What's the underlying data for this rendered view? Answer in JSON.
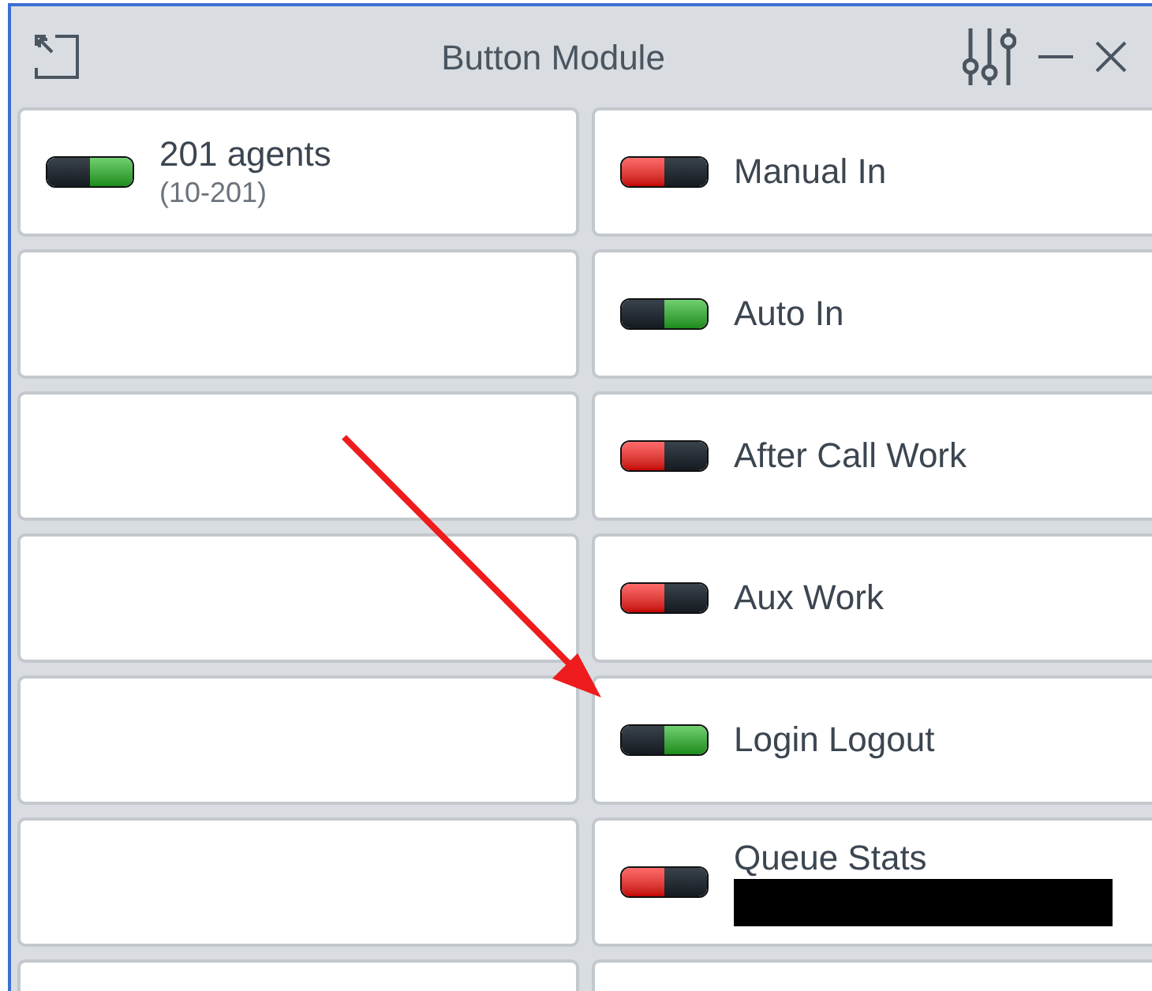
{
  "window": {
    "title": "Button Module"
  },
  "cells": [
    {
      "kind": "toggle",
      "label": "201 agents",
      "sublabel": "(10-201)",
      "on": true
    },
    {
      "kind": "toggle",
      "label": "Manual In",
      "on": false
    },
    {
      "kind": "empty"
    },
    {
      "kind": "toggle",
      "label": "Auto In",
      "on": true
    },
    {
      "kind": "empty"
    },
    {
      "kind": "toggle",
      "label": "After Call Work",
      "on": false
    },
    {
      "kind": "empty"
    },
    {
      "kind": "toggle",
      "label": "Aux Work",
      "on": false
    },
    {
      "kind": "empty"
    },
    {
      "kind": "toggle",
      "label": "Login Logout",
      "on": true
    },
    {
      "kind": "empty"
    },
    {
      "kind": "toggle",
      "label": "Queue Stats",
      "on": false,
      "redacted": true
    },
    {
      "kind": "empty"
    },
    {
      "kind": "empty"
    }
  ]
}
